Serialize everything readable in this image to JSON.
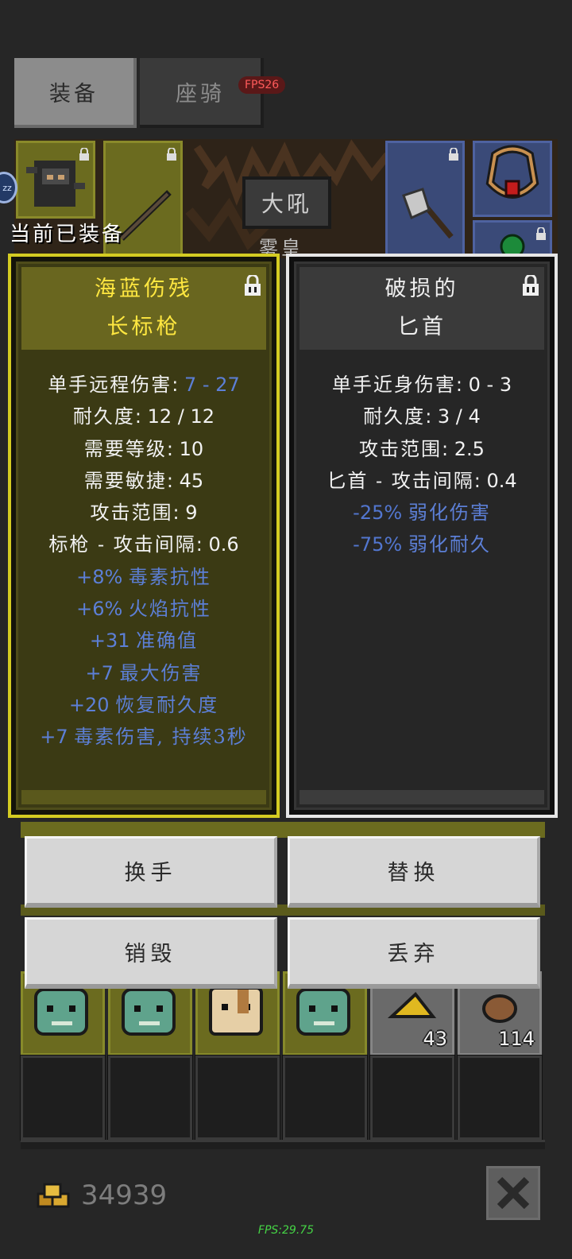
{
  "tabs": {
    "equip": "装备",
    "mount": "座骑"
  },
  "fps_top": "FPS26",
  "header": {
    "equipped_label": "当前已装备",
    "banner_text": "大吼",
    "banner_sub": "雾皇",
    "sleep_badge": "zz"
  },
  "left_card": {
    "name_line1": "海蓝伤残",
    "name_line2": "长标枪",
    "stats": [
      {
        "label": "单手远程伤害",
        "value": "7 - 27",
        "label_color": "#f2f2f2",
        "value_color": "#5c7fd6"
      },
      {
        "label": "耐久度",
        "value": "12 / 12"
      },
      {
        "label": "需要等级",
        "value": "10"
      },
      {
        "label": "需要敏捷",
        "value": "45"
      },
      {
        "label": "攻击范围",
        "value": "9"
      },
      {
        "label": "标枪 - 攻击间隔",
        "value": "0.6"
      }
    ],
    "bonuses": [
      {
        "value": "+8%",
        "label": "毒素抗性"
      },
      {
        "value": "+6%",
        "label": "火焰抗性"
      },
      {
        "value": "+31",
        "label": "准确值"
      },
      {
        "value": "+7",
        "label": "最大伤害"
      },
      {
        "value": "+20",
        "label": "恢复耐久度"
      },
      {
        "value": "+7",
        "label": "毒素伤害, 持续3秒"
      }
    ]
  },
  "right_card": {
    "name_line1": "破损的",
    "name_line2": "匕首",
    "stats": [
      {
        "label": "单手近身伤害",
        "value": "0 - 3"
      },
      {
        "label": "耐久度",
        "value": "3 / 4"
      },
      {
        "label": "攻击范围",
        "value": "2.5"
      },
      {
        "label": "匕首 - 攻击间隔",
        "value": "0.4"
      }
    ],
    "bonuses": [
      {
        "value": "-25%",
        "label": "弱化伤害"
      },
      {
        "value": "-75%",
        "label": "弱化耐久"
      }
    ]
  },
  "buttons": {
    "swap_hand": "换手",
    "replace": "替换",
    "destroy": "销毁",
    "drop": "丢弃"
  },
  "inventory": {
    "counts": [
      "43",
      "114"
    ]
  },
  "gold": "34939",
  "fps_bottom": "FPS:29.75",
  "colors": {
    "accent_yellow": "#ffe740",
    "stat_blue": "#5c7fd6",
    "card_left_border": "#d4cc22",
    "card_right_border": "#e6e6e6"
  }
}
